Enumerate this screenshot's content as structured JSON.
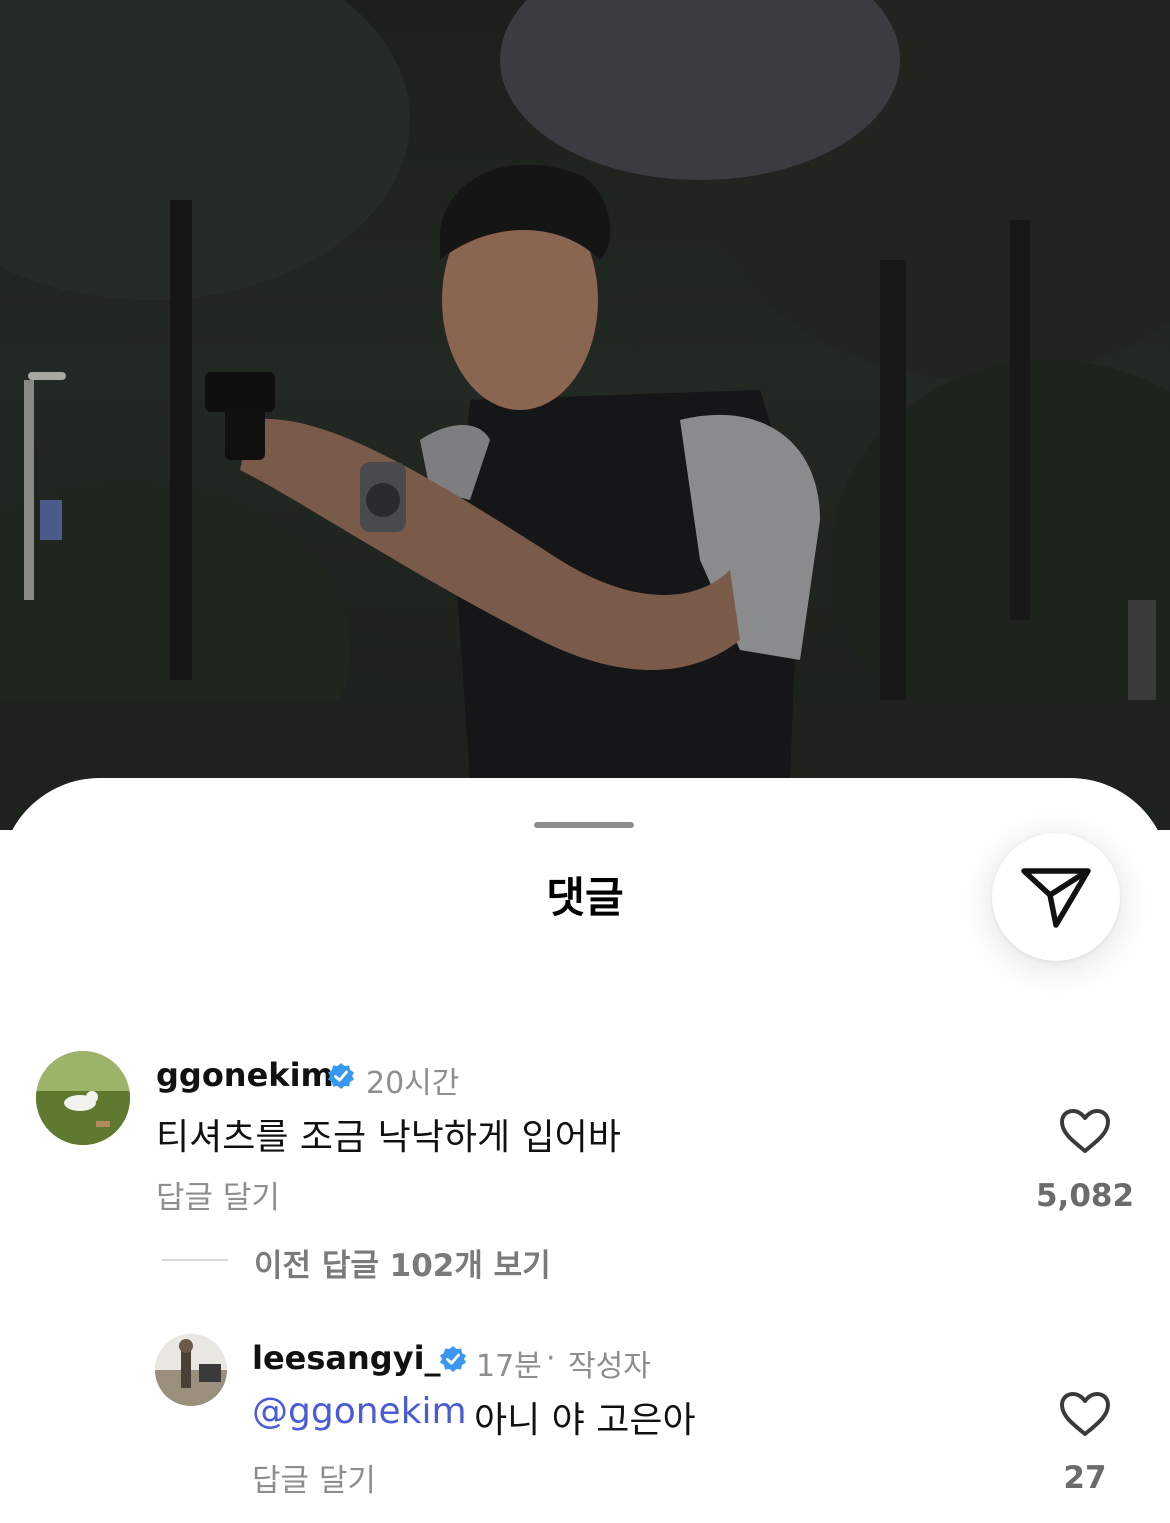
{
  "sheet": {
    "title": "댓글"
  },
  "share_icon": "paper-plane-icon",
  "comments": [
    {
      "username": "ggonekim",
      "verified": true,
      "time": "20시간",
      "text": "티셔츠를 조금 낙낙하게 입어바",
      "reply_label": "답글 달기",
      "like_count": "5,082",
      "view_replies": "이전 답글 102개 보기"
    },
    {
      "username": "leesangyi_",
      "verified": true,
      "time": "17분",
      "separator": "·",
      "author_tag": "작성자",
      "mention": "@ggonekim",
      "text": "아니 야 고은아",
      "reply_label": "답글 달기",
      "like_count": "27"
    }
  ],
  "colors": {
    "verified_badge": "#3897f0",
    "mention": "#4a5bd6",
    "secondary_text": "#8e8e8e"
  }
}
